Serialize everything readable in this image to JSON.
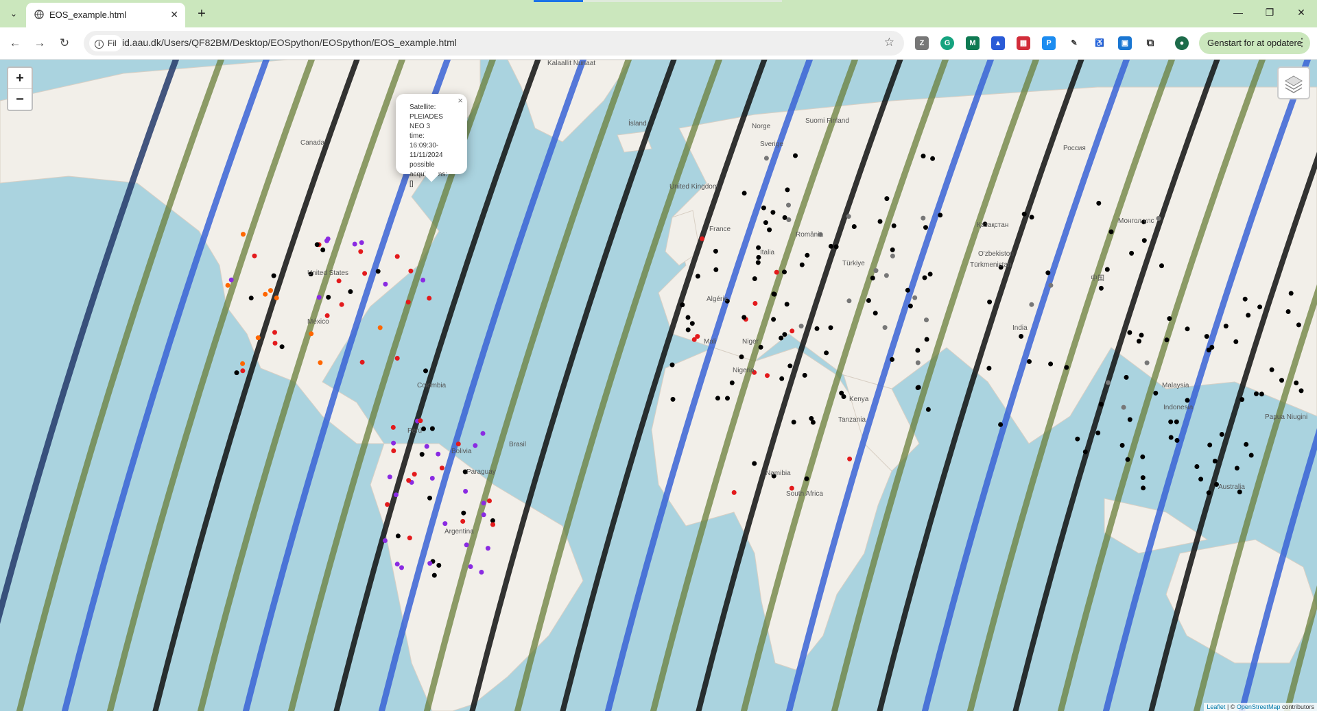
{
  "browser": {
    "tab_title": "EOS_example.html",
    "new_tab": "+",
    "url_badge": "Fil",
    "url": "id.aau.dk/Users/QF82BM/Desktop/EOSpython/EOSpython/EOS_example.html",
    "update_button": "Genstart for at opdatere",
    "window": {
      "minimize": "—",
      "restore": "❐",
      "close": "✕"
    }
  },
  "map": {
    "zoom_in": "+",
    "zoom_out": "−",
    "popup": {
      "close": "×",
      "lines": [
        "Satellite:",
        "PLEIADES",
        "NEO 3",
        "time:",
        "16:09:30-",
        "11/11/2024",
        "possible",
        "acquisitions:",
        "[]"
      ]
    },
    "attribution": {
      "leaflet": "Leaflet",
      "sep": " | © ",
      "osm": "OpenStreetMap",
      "suffix": " contributors"
    },
    "labels": [
      {
        "id": "kalaallit",
        "text": "Kalaallit Nunaat"
      },
      {
        "id": "canada",
        "text": "Canada"
      },
      {
        "id": "united-states",
        "text": "United States"
      },
      {
        "id": "mexico",
        "text": "México"
      },
      {
        "id": "colombia",
        "text": "Colombia"
      },
      {
        "id": "peru",
        "text": "Perú"
      },
      {
        "id": "brasil",
        "text": "Brasil"
      },
      {
        "id": "bolivia",
        "text": "Bolivia"
      },
      {
        "id": "paraguay",
        "text": "Paraguay"
      },
      {
        "id": "argentina",
        "text": "Argentina"
      },
      {
        "id": "island",
        "text": "Ísland"
      },
      {
        "id": "norge",
        "text": "Norge"
      },
      {
        "id": "suomi",
        "text": "Suomi Finland"
      },
      {
        "id": "sverige",
        "text": "Sverige"
      },
      {
        "id": "uk",
        "text": "United Kingdom"
      },
      {
        "id": "france",
        "text": "France"
      },
      {
        "id": "italia",
        "text": "Italia"
      },
      {
        "id": "romania",
        "text": "România"
      },
      {
        "id": "turkiye",
        "text": "Türkiye"
      },
      {
        "id": "algerie",
        "text": "Algérie"
      },
      {
        "id": "mali",
        "text": "Mali"
      },
      {
        "id": "niger",
        "text": "Niger"
      },
      {
        "id": "nigeria",
        "text": "Nigeria"
      },
      {
        "id": "kenya",
        "text": "Kenya"
      },
      {
        "id": "tanzania",
        "text": "Tanzania"
      },
      {
        "id": "namibia",
        "text": "Namibia"
      },
      {
        "id": "south-africa",
        "text": "South Africa"
      },
      {
        "id": "rossiya",
        "text": "Россия"
      },
      {
        "id": "kazakhstan",
        "text": "Қазақстан"
      },
      {
        "id": "mongol",
        "text": "Монгол улс"
      },
      {
        "id": "uzbekistan",
        "text": "O'zbekiston"
      },
      {
        "id": "turkmenistan",
        "text": "Türkmenistan"
      },
      {
        "id": "china",
        "text": "中国"
      },
      {
        "id": "india",
        "text": "India"
      },
      {
        "id": "malaysia",
        "text": "Malaysia"
      },
      {
        "id": "indonesia",
        "text": "Indonesia"
      },
      {
        "id": "papua",
        "text": "Papua Niugini"
      },
      {
        "id": "australia",
        "text": "Australia"
      }
    ],
    "colors": {
      "ocean": "#aad3df",
      "land": "#f2efe9",
      "track_black": "#111111",
      "track_blue": "#3a63d6",
      "track_olive": "#6a7f3a",
      "track_navy": "#243a6b"
    }
  }
}
